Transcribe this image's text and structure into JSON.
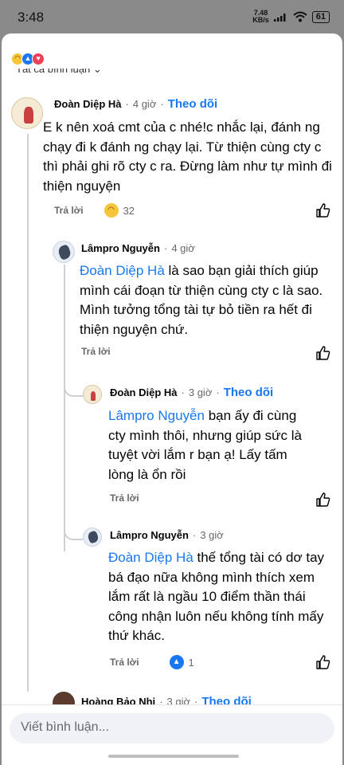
{
  "status_bar": {
    "time": "3:48",
    "net_speed_value": "7.48",
    "net_speed_unit": "KB/s",
    "battery": "61"
  },
  "reaction_summary": {
    "icons": [
      "haha",
      "like",
      "love"
    ]
  },
  "filter_label": "Tất cả bình luận",
  "comments": [
    {
      "author": "Đoàn Diệp Hà",
      "time": "4 giờ",
      "follow": "Theo dõi",
      "text": "E k nên xoá cmt của c nhé!c nhắc lại, đánh ng chạy đi k đánh ng chạy lại. Từ thiện cùng cty c thì phải ghi rõ cty c ra. Đừng làm như tự mình đi thiện nguyện",
      "reply": "Trả lời",
      "reaction_icon": "haha",
      "reaction_count": "32"
    },
    {
      "author": "Lâmpro Nguyễn",
      "time": "4 giờ",
      "mention": "Đoàn Diệp Hà",
      "text": " là sao bạn giải thích giúp mình cái đoạn từ thiện cùng cty c là sao. Mình tưởng tổng tài tự bỏ tiền ra hết đi thiện nguyện chứ.",
      "reply": "Trả lời"
    },
    {
      "author": "Đoàn Diệp Hà",
      "time": "3 giờ",
      "follow": "Theo dõi",
      "mention": "Lâmpro Nguyễn",
      "text": " bạn ấy đi cùng cty mình thôi, nhưng giúp sức là tuyệt vời lắm r bạn ạ! Lấy tấm lòng là ổn rồi",
      "reply": "Trả lời"
    },
    {
      "author": "Lâmpro Nguyễn",
      "time": "3 giờ",
      "mention": "Đoàn Diệp Hà",
      "text": " thế tổng tài có dơ tay bá đạo nữa không mình thích xem lắm rất là ngầu 10 điểm thần thái công nhận luôn nếu không tính mấy thứ khác.",
      "reply": "Trả lời",
      "reaction_icon": "like",
      "reaction_count": "1"
    },
    {
      "author": "Hoàng Bảo Nhi",
      "time": "3 giờ",
      "follow": "Theo dõi"
    }
  ],
  "separator": "·",
  "composer": {
    "placeholder": "Viết bình luận..."
  },
  "colors": {
    "accent": "#1877f2",
    "muted": "#65676b",
    "line": "#ced0d4"
  }
}
